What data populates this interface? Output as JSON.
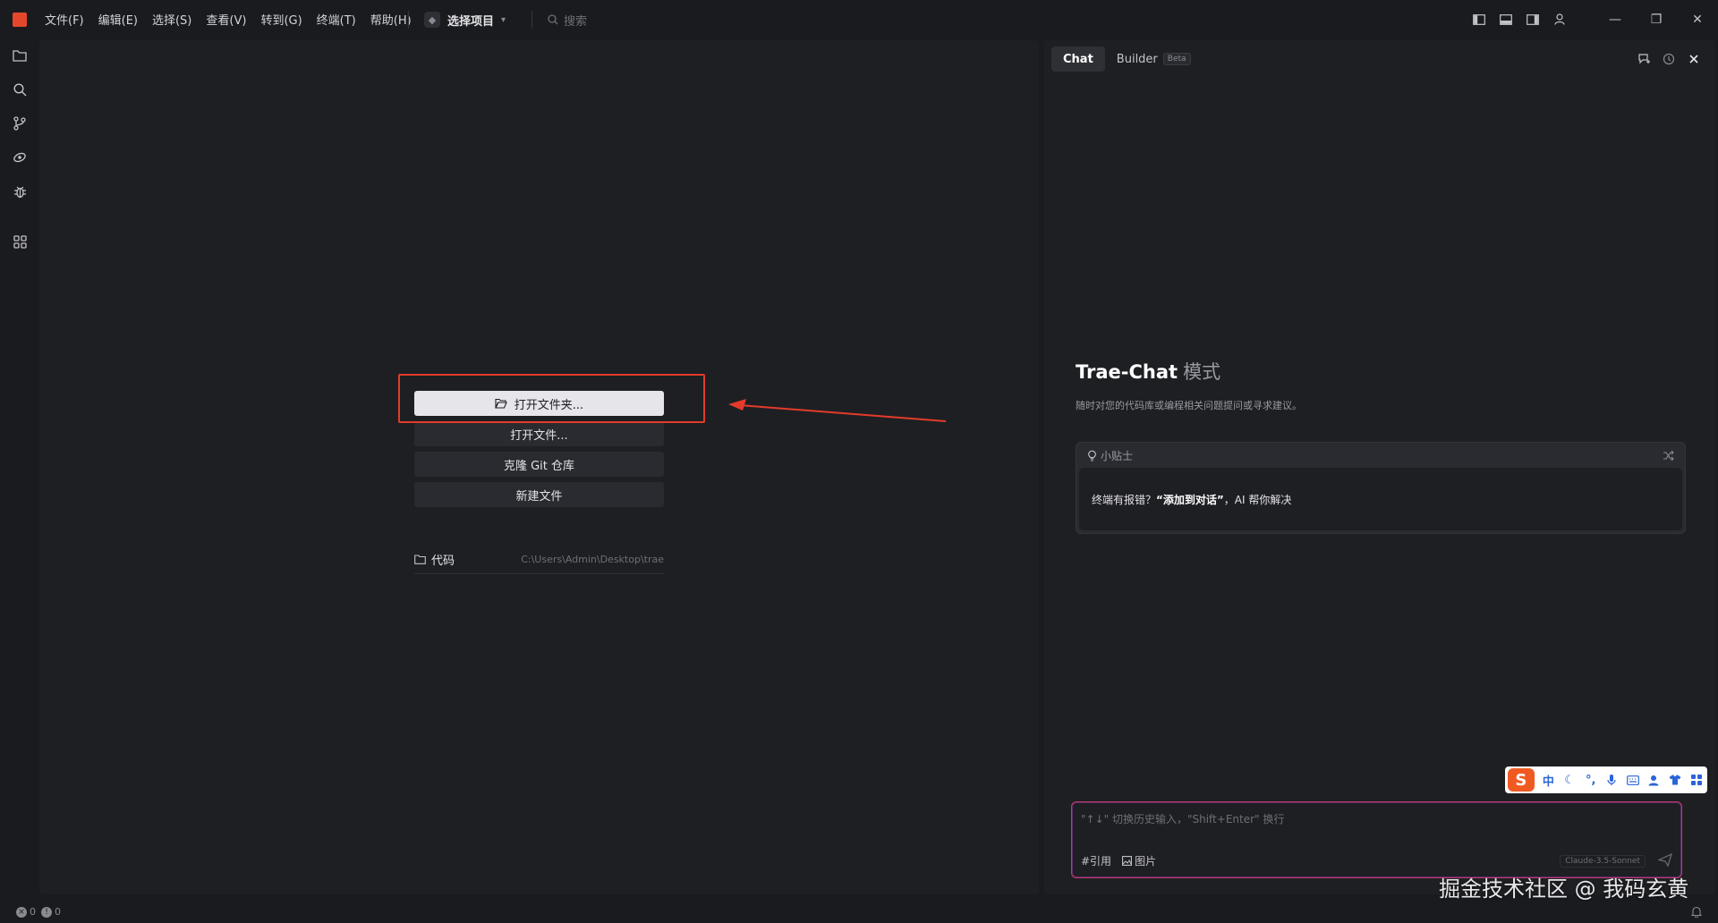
{
  "titlebar": {
    "menu": [
      "文件(F)",
      "编辑(E)",
      "选择(S)",
      "查看(V)",
      "转到(G)",
      "终端(T)",
      "帮助(H)"
    ],
    "project_label": "选择项目",
    "search_placeholder": "搜索"
  },
  "editor": {
    "actions": {
      "open_folder": "打开文件夹...",
      "open_file": "打开文件...",
      "clone_git": "克隆 Git 仓库",
      "new_file": "新建文件"
    },
    "recent": {
      "name": "代码",
      "path": "C:\\Users\\Admin\\Desktop\\trae"
    }
  },
  "chat": {
    "tabs": {
      "chat": "Chat",
      "builder": "Builder",
      "beta": "Beta"
    },
    "mode_title": "Trae-Chat",
    "mode_suffix": "模式",
    "mode_desc": "随时对您的代码库或编程相关问题提问或寻求建议。",
    "tips_label": "小贴士",
    "tips_text_pre": "终端有报错？",
    "tips_text_bold": "“添加到对话”",
    "tips_text_post": "，AI 帮你解决",
    "input_placeholder": "\"↑↓\" 切换历史输入，\"Shift+Enter\" 换行",
    "tool_ref": "#引用",
    "tool_image": "图片",
    "model": "Claude-3.5-Sonnet"
  },
  "ime": {
    "logo": "S",
    "mode": "中"
  },
  "statusbar": {
    "errors": "0",
    "warnings": "0"
  },
  "watermark": "掘金技术社区 @ 我码玄黄",
  "colors": {
    "accent": "#e33b2b",
    "app_logo": "#e5472d",
    "ime_logo": "#f05a22"
  }
}
